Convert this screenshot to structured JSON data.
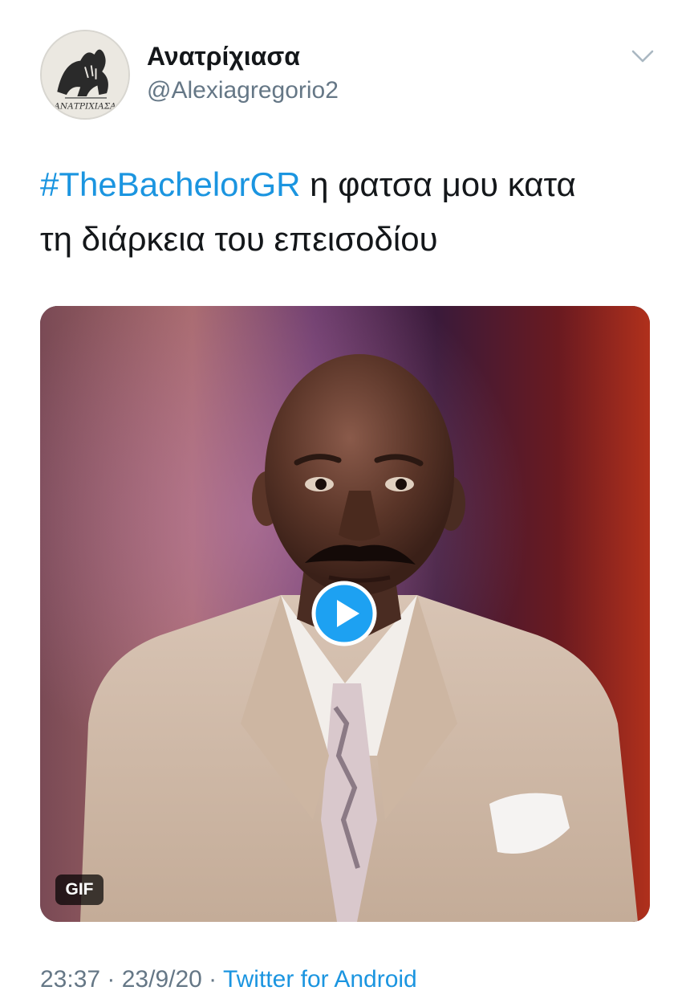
{
  "user": {
    "display_name": "Ανατρίχιασα",
    "handle": "@Alexiagregorio2",
    "avatar_icon": "black-cat-illustration",
    "avatar_text": "ΑΝΑΤΡΙΧΙΑΣΑ"
  },
  "tweet": {
    "hashtag": "#TheBachelorGR",
    "text_line1_rest": " η φατσα μου κατα",
    "text_line2": "τη διάρκεια  του επεισοδίου"
  },
  "media": {
    "badge": "GIF",
    "play_icon": "play-icon"
  },
  "meta": {
    "time": "23:37",
    "sep1": " · ",
    "date": "23/9/20",
    "sep2": " · ",
    "client": "Twitter for Android"
  },
  "colors": {
    "link": "#1b95e0",
    "secondary_text": "#657786",
    "primary_text": "#14171a"
  }
}
